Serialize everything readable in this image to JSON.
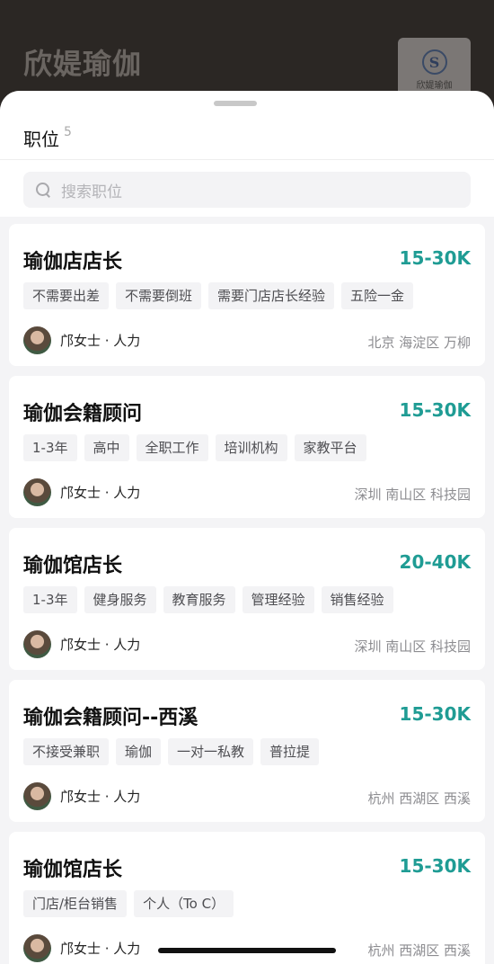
{
  "header": {
    "company_name": "欣媞瑜伽",
    "logo_initial": "S",
    "logo_text": "欣媞瑜伽"
  },
  "sheet": {
    "title": "职位",
    "count": "5",
    "search_placeholder": "搜索职位"
  },
  "jobs": [
    {
      "title": "瑜伽店店长",
      "salary": "15-30K",
      "tags": [
        "不需要出差",
        "不需要倒班",
        "需要门店店长经验",
        "五险一金"
      ],
      "recruiter": "邝女士 · 人力",
      "location": "北京 海淀区 万柳"
    },
    {
      "title": "瑜伽会籍顾问",
      "salary": "15-30K",
      "tags": [
        "1-3年",
        "高中",
        "全职工作",
        "培训机构",
        "家教平台"
      ],
      "recruiter": "邝女士 · 人力",
      "location": "深圳 南山区 科技园"
    },
    {
      "title": "瑜伽馆店长",
      "salary": "20-40K",
      "tags": [
        "1-3年",
        "健身服务",
        "教育服务",
        "管理经验",
        "销售经验"
      ],
      "recruiter": "邝女士 · 人力",
      "location": "深圳 南山区 科技园"
    },
    {
      "title": "瑜伽会籍顾问--西溪",
      "salary": "15-30K",
      "tags": [
        "不接受兼职",
        "瑜伽",
        "一对一私教",
        "普拉提"
      ],
      "recruiter": "邝女士 · 人力",
      "location": "杭州 西湖区 西溪"
    },
    {
      "title": "瑜伽馆店长",
      "salary": "15-30K",
      "tags": [
        "门店/柜台销售",
        "个人（To C）"
      ],
      "recruiter": "邝女士 · 人力",
      "location": "杭州 西湖区 西溪"
    }
  ],
  "colors": {
    "salary": "#1f9c94",
    "background_header": "#2b2724"
  }
}
